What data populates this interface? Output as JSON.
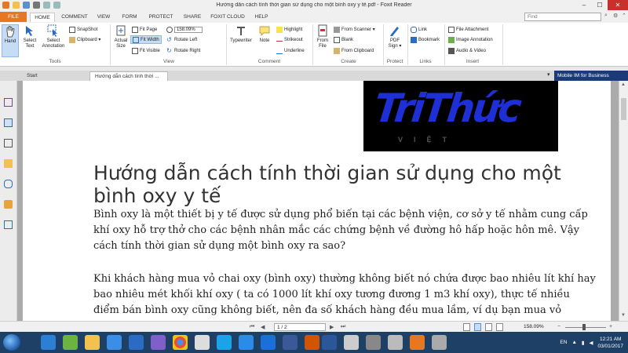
{
  "window": {
    "title": "Hướng dẫn cách tính thời gian sử dụng cho một bình oxy y tế.pdf - Foxit Reader",
    "controls": [
      "–",
      "☐",
      "✕"
    ]
  },
  "ribbon_tabs": [
    "FILE",
    "HOME",
    "COMMENT",
    "VIEW",
    "FORM",
    "PROTECT",
    "SHARE",
    "FOXIT CLOUD",
    "HELP"
  ],
  "search": {
    "placeholder": "Find"
  },
  "ribbon": {
    "groups": {
      "tools": "Tools",
      "view": "View",
      "comment": "Comment",
      "create": "Create",
      "protect": "Protect",
      "links": "Links",
      "insert": "Insert"
    },
    "hand": "Hand",
    "select_text": "Select Text",
    "select_annotation": "Select Annotation",
    "snapshot": "SnapShot",
    "clipboard": "Clipboard ▾",
    "actual_size": "Actual Size",
    "fit_page": "Fit Page",
    "fit_width": "Fit Width",
    "fit_visible": "Fit Visible",
    "zoom_value": "158.09%",
    "rotate_left": "Rotate Left",
    "rotate_right": "Rotate Right",
    "typewriter": "Typewriter",
    "note": "Note",
    "highlight": "Highlight",
    "strikeout": "Strikeout",
    "underline": "Underline",
    "from_file": "From File",
    "from_scanner": "From Scanner ▾",
    "blank": "Blank",
    "from_clipboard": "From Clipboard",
    "pdf_sign": "PDF Sign ▾",
    "link": "Link",
    "bookmark": "Bookmark",
    "file_attachment": "File Attachment",
    "image_annotation": "Image Annotation",
    "audio_video": "Audio & Video"
  },
  "doc_tabs": {
    "start": "Start",
    "active": "Hướng dẫn cách tính thời ..."
  },
  "ad_banner": "Mobile IM for Business",
  "document": {
    "logo_text": "TriThức",
    "logo_sub": "VIỆT",
    "title": "Hướng dẫn cách tính thời gian sử dụng cho một bình oxy y tế",
    "paragraph1": "Bình oxy là một thiết bị y tế được sử dụng phổ biến tại các bệnh viện, cơ sở y tế nhằm cung cấp khí oxy hỗ trợ thở cho các bệnh nhân mắc các chứng bệnh về đường hô hấp hoặc hôn mê. Vậy cách tính thời gian sử dụng một bình oxy ra sao?",
    "paragraph2": "Khi khách hàng mua vỏ chai oxy (bình oxy) thường không biết nó chứa được bao nhiêu lít khí hay bao nhiêu mét khối khí oxy ( ta có 1000 lít khí oxy tương đương 1 m3 khí oxy), thực tế nhiều điểm bán bình oxy cũng không biết, nên đa số khách hàng đều mua lầm, ví dụ bạn mua vỏ"
  },
  "statusbar": {
    "page": "1 / 2",
    "zoom": "158.09%",
    "zoom_minus": "−",
    "zoom_plus": "+"
  },
  "taskbar": {
    "lang": "EN",
    "time": "12:21 AM",
    "date": "03/01/2017"
  },
  "colors": {
    "accent_orange": "#e87722",
    "logo_blue": "#1e2fd6",
    "taskbar": "#1e3f66"
  }
}
